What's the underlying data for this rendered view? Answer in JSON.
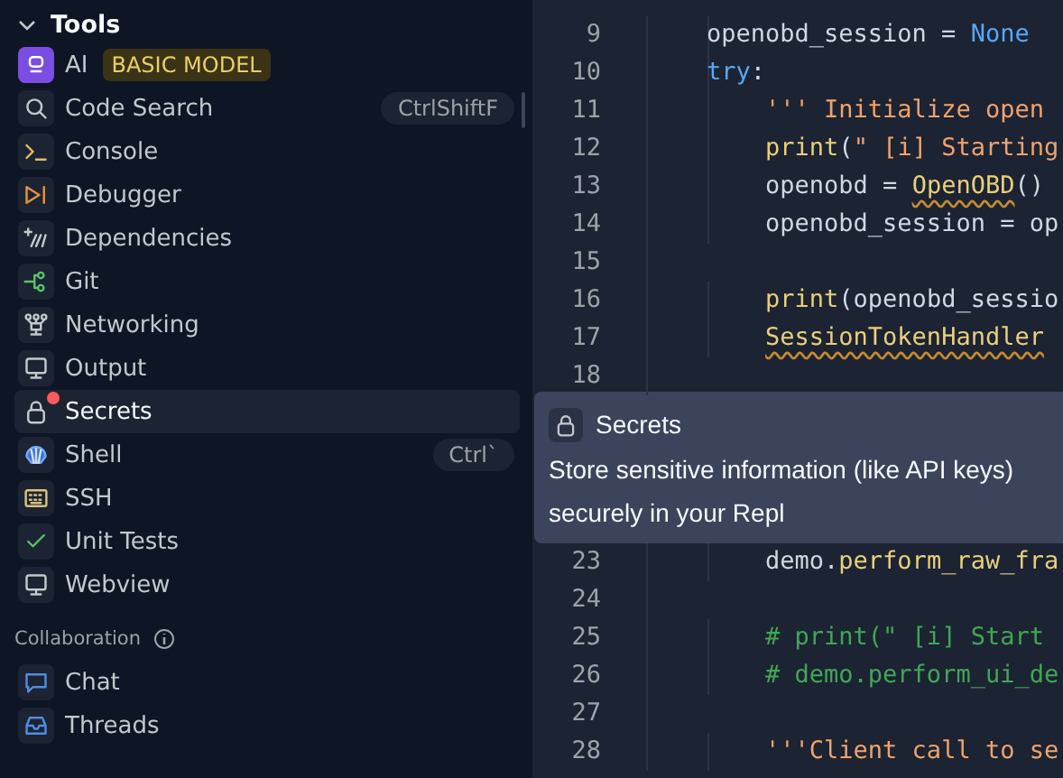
{
  "sidebar": {
    "section_title": "Tools",
    "expanded": true,
    "items": [
      {
        "label": "AI",
        "badge": "BASIC MODEL",
        "selected": false,
        "notification": false
      },
      {
        "label": "Code Search",
        "shortcut": "CtrlShiftF",
        "selected": false,
        "notification": false
      },
      {
        "label": "Console",
        "selected": false,
        "notification": false
      },
      {
        "label": "Debugger",
        "selected": false,
        "notification": false
      },
      {
        "label": "Dependencies",
        "selected": false,
        "notification": false
      },
      {
        "label": "Git",
        "selected": false,
        "notification": false
      },
      {
        "label": "Networking",
        "selected": false,
        "notification": false
      },
      {
        "label": "Output",
        "selected": false,
        "notification": false
      },
      {
        "label": "Secrets",
        "selected": true,
        "notification": true
      },
      {
        "label": "Shell",
        "shortcut": "Ctrl`",
        "selected": false,
        "notification": false
      },
      {
        "label": "SSH",
        "selected": false,
        "notification": false
      },
      {
        "label": "Unit Tests",
        "selected": false,
        "notification": false
      },
      {
        "label": "Webview",
        "selected": false,
        "notification": false
      }
    ],
    "collaboration": {
      "title": "Collaboration",
      "items": [
        {
          "label": "Chat",
          "selected": false,
          "notification": false
        },
        {
          "label": "Threads",
          "selected": false,
          "notification": false
        }
      ]
    }
  },
  "editor": {
    "lines": [
      {
        "number": "9",
        "tokens": [
          {
            "kind": "plain",
            "text": "    openobd_session = "
          },
          {
            "kind": "keyword",
            "text": "None"
          }
        ]
      },
      {
        "number": "10",
        "tokens": [
          {
            "kind": "keyword",
            "text": "    try"
          },
          {
            "kind": "plain",
            "text": ":"
          }
        ]
      },
      {
        "number": "11",
        "tokens": [
          {
            "kind": "string",
            "text": "        ''' Initialize open"
          }
        ]
      },
      {
        "number": "12",
        "tokens": [
          {
            "kind": "function",
            "text": "        print"
          },
          {
            "kind": "plain",
            "text": "("
          },
          {
            "kind": "string",
            "text": "\" [i] Starting"
          }
        ]
      },
      {
        "number": "13",
        "tokens": [
          {
            "kind": "plain",
            "text": "        openobd = "
          },
          {
            "kind": "function",
            "text": "OpenOBD",
            "squiggle": true
          },
          {
            "kind": "plain",
            "text": "()"
          }
        ]
      },
      {
        "number": "14",
        "tokens": [
          {
            "kind": "plain",
            "text": "        openobd_session = op"
          }
        ]
      },
      {
        "number": "15"
      },
      {
        "number": "16",
        "tokens": [
          {
            "kind": "function",
            "text": "        print"
          },
          {
            "kind": "plain",
            "text": "(openobd_sessio"
          }
        ]
      },
      {
        "number": "17",
        "tokens": [
          {
            "kind": "function",
            "text": "        SessionTokenHandler",
            "squiggle": true
          }
        ]
      },
      {
        "number": "18"
      },
      {
        "kind": "tooltip",
        "title": "Secrets",
        "description": "Store sensitive information (like API keys) securely in your Repl"
      },
      {
        "number": "23",
        "tokens": [
          {
            "kind": "plain",
            "text": "        demo."
          },
          {
            "kind": "function",
            "text": "perform_raw_fra"
          }
        ]
      },
      {
        "number": "24"
      },
      {
        "number": "25",
        "tokens": [
          {
            "kind": "comment",
            "text": "        # print(\" [i] Start"
          }
        ]
      },
      {
        "number": "26",
        "tokens": [
          {
            "kind": "comment",
            "text": "        # demo.perform_ui_de"
          }
        ]
      },
      {
        "number": "27"
      },
      {
        "number": "28",
        "tokens": [
          {
            "kind": "string",
            "text": "        '''Client call to se"
          }
        ]
      }
    ]
  }
}
